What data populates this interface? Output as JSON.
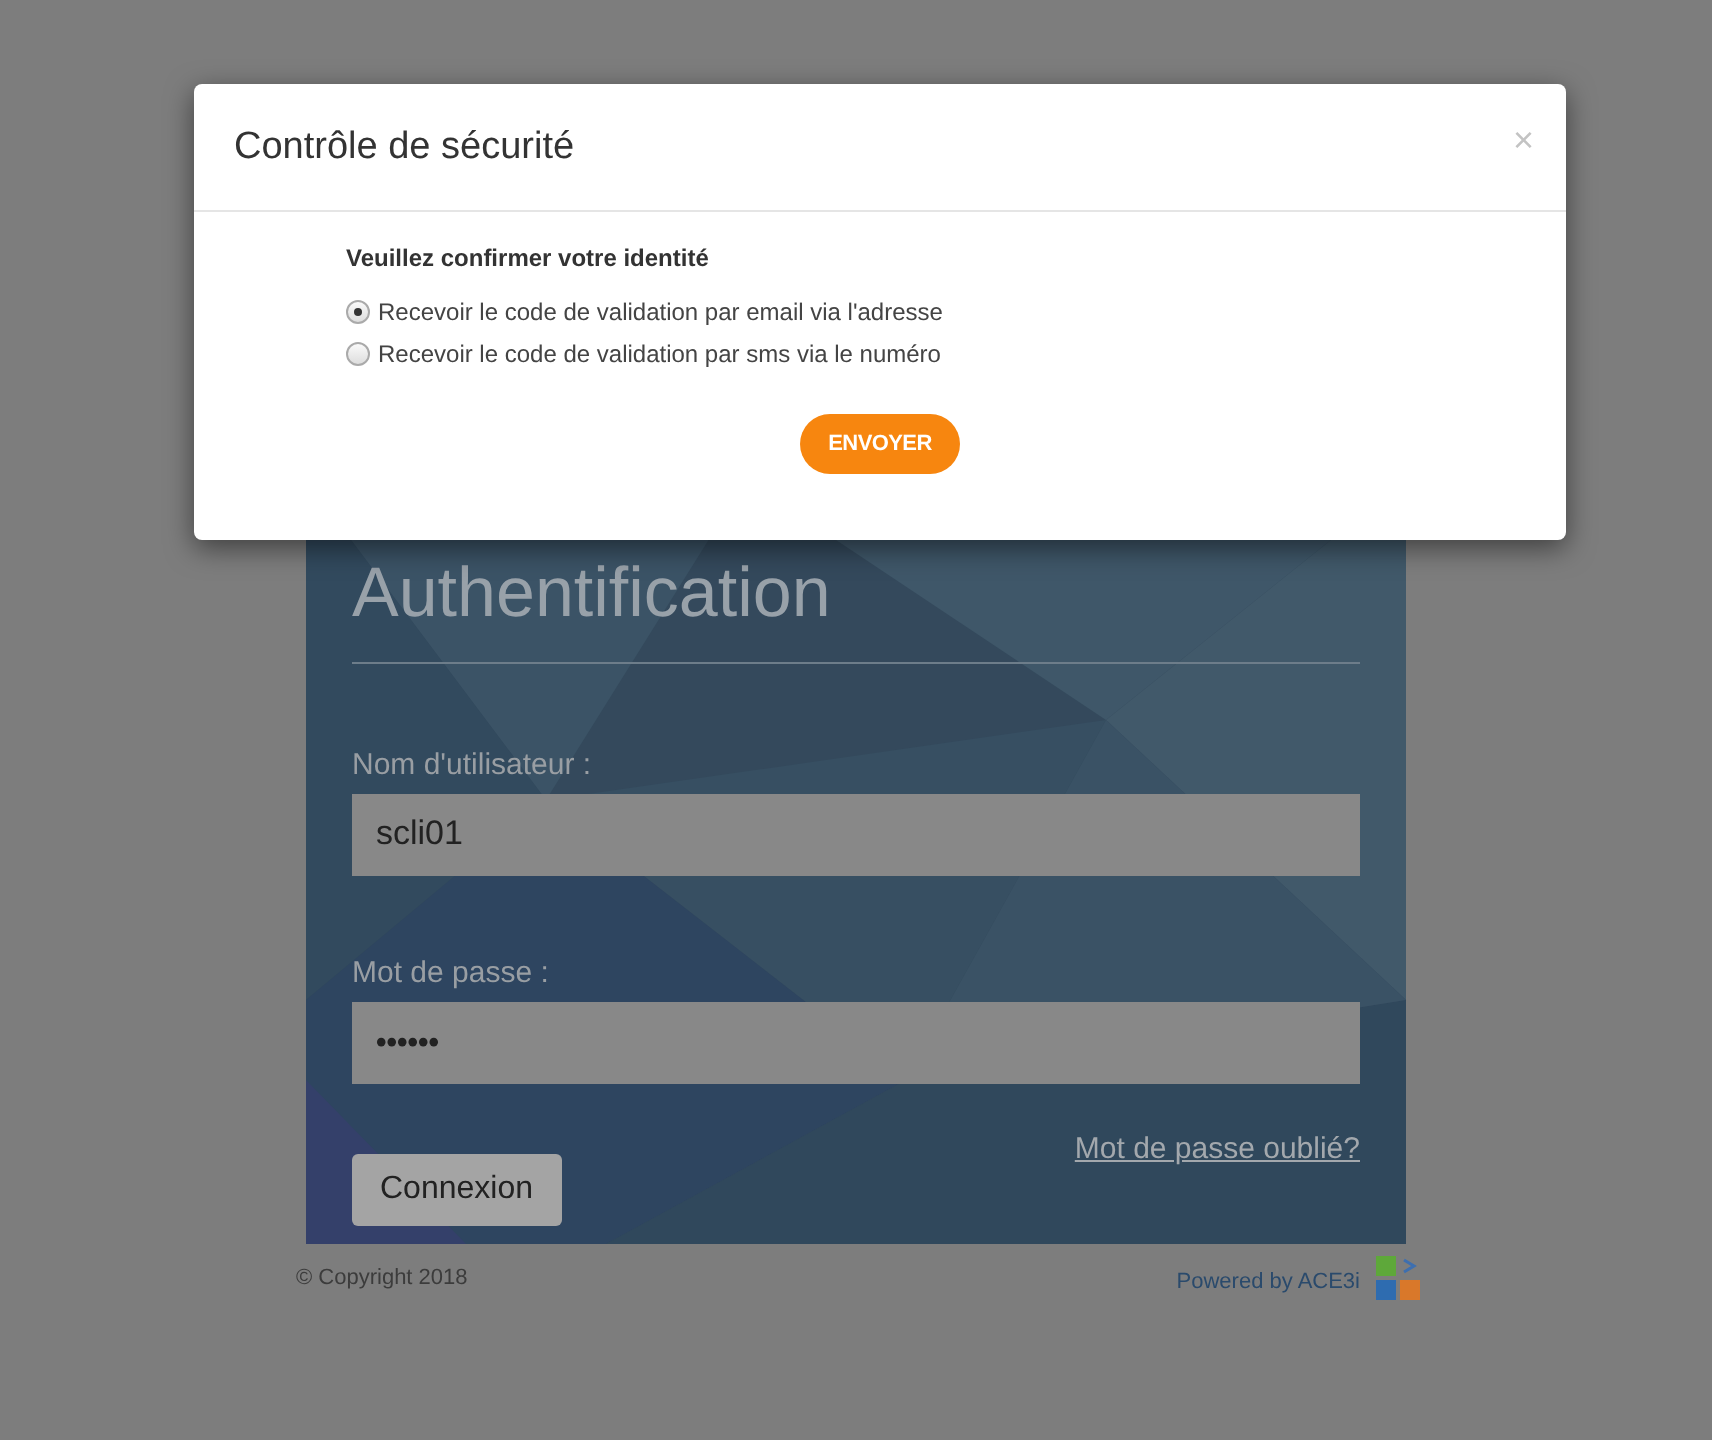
{
  "modal": {
    "title": "Contrôle de sécurité",
    "close": "×",
    "prompt": "Veuillez confirmer votre identité",
    "options": [
      {
        "label": "Recevoir le code de validation par email via l'adresse",
        "selected": true
      },
      {
        "label": "Recevoir le code de validation par sms via le numéro",
        "selected": false
      }
    ],
    "submit": "ENVOYER"
  },
  "login": {
    "title": "Authentification",
    "fields": [
      {
        "label": "Nom d'utilisateur :",
        "value": "scli01",
        "kind": "text"
      },
      {
        "label": "Mot de passe :",
        "value": "••••••",
        "kind": "password"
      }
    ],
    "forgot_link": "Mot de passe oublié?",
    "button": "Connexion"
  },
  "footer": {
    "copyright": "© Copyright 2018",
    "powered_by": "Powered by ACE3i"
  }
}
